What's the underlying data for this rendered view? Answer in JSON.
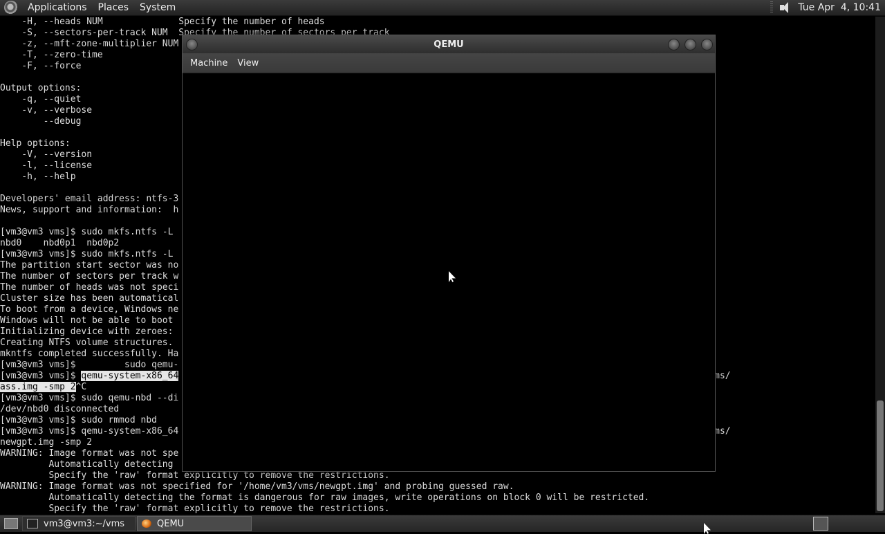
{
  "top_panel": {
    "menus": [
      "Applications",
      "Places",
      "System"
    ],
    "clock": "Tue Apr  4, 10:41"
  },
  "terminal": {
    "lines": [
      "    -H, --heads NUM              Specify the number of heads",
      "    -S, --sectors-per-track NUM  Specify the number of sectors per track",
      "    -z, --mft-zone-multiplier NUM",
      "    -T, --zero-time",
      "    -F, --force",
      "",
      "Output options:",
      "    -q, --quiet",
      "    -v, --verbose",
      "        --debug",
      "",
      "Help options:",
      "    -V, --version",
      "    -l, --license",
      "    -h, --help",
      "",
      "Developers' email address: ntfs-3",
      "News, support and information:  h",
      "",
      "[vm3@vm3 vms]$ sudo mkfs.ntfs -L",
      "nbd0    nbd0p1  nbd0p2",
      "[vm3@vm3 vms]$ sudo mkfs.ntfs -L",
      "The partition start sector was no",
      "The number of sectors per track w                                                                                 0.",
      "The number of heads was not speci",
      "Cluster size has been automatical",
      "To boot from a device, Windows ne",
      "Windows will not be able to boot",
      "Initializing device with zeroes:",
      "Creating NTFS volume structures.",
      "mkntfs completed successfully. Ha",
      "[vm3@vm3 vms]$         sudo qemu-",
      "[vm3@vm3 vms]$ |SEL|qemu-system-x86_64                                                                          g -drive file=/home/vm3/vms/",
      "|SEL|ass.img -smp 2|/SEL|^C",
      "[vm3@vm3 vms]$ sudo qemu-nbd --di",
      "/dev/nbd0 disconnected",
      "[vm3@vm3 vms]$ sudo rmmod nbd",
      "[vm3@vm3 vms]$ qemu-system-x86_64                                                                          g -drive file=/home/vm3/vms/",
      "newgpt.img -smp 2",
      "WARNING: Image format was not spe",
      "         Automatically detecting",
      "         Specify the 'raw' format explicitly to remove the restrictions.",
      "WARNING: Image format was not specified for '/home/vm3/vms/newgpt.img' and probing guessed raw.",
      "         Automatically detecting the format is dangerous for raw images, write operations on block 0 will be restricted.",
      "         Specify the 'raw' format explicitly to remove the restrictions."
    ]
  },
  "qemu_window": {
    "title": "QEMU",
    "menus": [
      "Machine",
      "View"
    ]
  },
  "bottom_panel": {
    "tasks": [
      {
        "label": "vm3@vm3:~/vms",
        "icon": "terminal-icon",
        "active": false
      },
      {
        "label": "QEMU",
        "icon": "qemu-icon",
        "active": true
      }
    ]
  }
}
